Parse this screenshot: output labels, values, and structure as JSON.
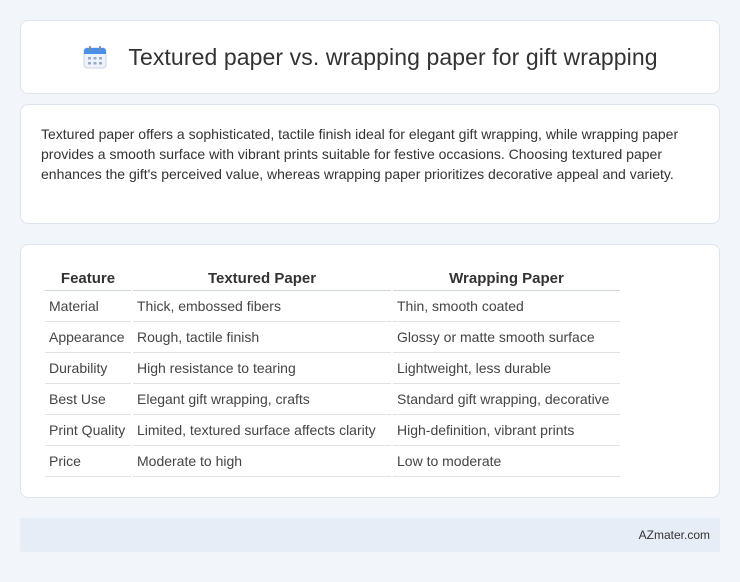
{
  "header": {
    "icon": "calendar-icon",
    "title": "Textured paper vs. wrapping paper for gift wrapping"
  },
  "summary": {
    "text": "Textured paper offers a sophisticated, tactile finish ideal for elegant gift wrapping, while wrapping paper provides a smooth surface with vibrant prints suitable for festive occasions. Choosing textured paper enhances the gift's perceived value, whereas wrapping paper prioritizes decorative appeal and variety."
  },
  "table": {
    "headers": [
      "Feature",
      "Textured Paper",
      "Wrapping Paper"
    ],
    "rows": [
      [
        "Material",
        "Thick, embossed fibers",
        "Thin, smooth coated"
      ],
      [
        "Appearance",
        "Rough, tactile finish",
        "Glossy or matte smooth surface"
      ],
      [
        "Durability",
        "High resistance to tearing",
        "Lightweight, less durable"
      ],
      [
        "Best Use",
        "Elegant gift wrapping, crafts",
        "Standard gift wrapping, decorative"
      ],
      [
        "Print Quality",
        "Limited, textured surface affects clarity",
        "High-definition, vibrant prints"
      ],
      [
        "Price",
        "Moderate to high",
        "Low to moderate"
      ]
    ]
  },
  "footer": {
    "brand": "AZmater.com"
  },
  "colors": {
    "background": "#f2f5fa",
    "card": "#ffffff",
    "footer": "#e7edf6",
    "icon_blue": "#4a8fe7"
  }
}
